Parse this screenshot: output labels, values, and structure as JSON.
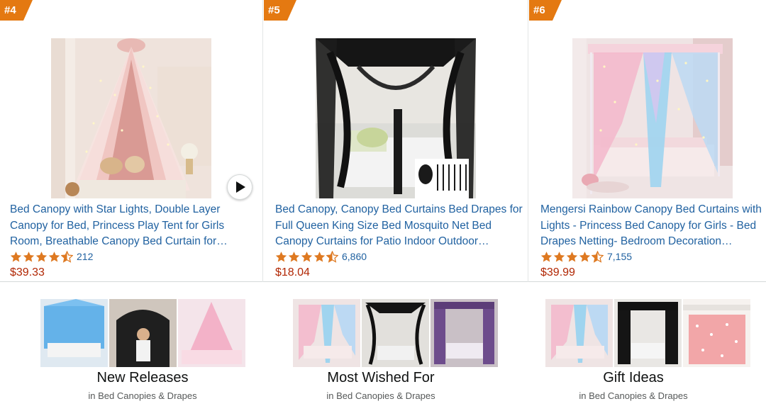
{
  "products": [
    {
      "rank": "#4",
      "title": "Bed Canopy with Star Lights, Double Layer Canopy for Bed, Princess Play Tent for Girls Room, Breathable Canopy Bed Curtain for…",
      "rating": 4.5,
      "review_count": "212",
      "price": "$39.33",
      "has_video": true,
      "image": "pink-hanging-bed-canopy-photo"
    },
    {
      "rank": "#5",
      "title": "Bed Canopy, Canopy Bed Curtains Bed Drapes for Full Queen King Size Bed Mosquito Net Bed Canopy Curtains for Patio Indoor Outdoor…",
      "rating": 4.5,
      "review_count": "6,860",
      "price": "$18.04",
      "has_video": false,
      "image": "black-four-poster-canopy-photo"
    },
    {
      "rank": "#6",
      "title": "Mengersi Rainbow Canopy Bed Curtains with Lights - Princess Bed Canopy for Girls - Bed Drapes Netting- Bedroom Decoration…",
      "rating": 4.5,
      "review_count": "7,155",
      "price": "$39.99",
      "has_video": false,
      "image": "rainbow-canopy-bed-photo"
    }
  ],
  "categories": [
    {
      "title": "New Releases",
      "subtitle": "in Bed Canopies & Drapes"
    },
    {
      "title": "Most Wished For",
      "subtitle": "in Bed Canopies & Drapes"
    },
    {
      "title": "Gift Ideas",
      "subtitle": "in Bed Canopies & Drapes"
    }
  ],
  "colors": {
    "rank_badge": "#e47911",
    "title_link": "#2162a1",
    "price": "#b12704",
    "star": "#de7921",
    "subtitle": "#565959"
  }
}
